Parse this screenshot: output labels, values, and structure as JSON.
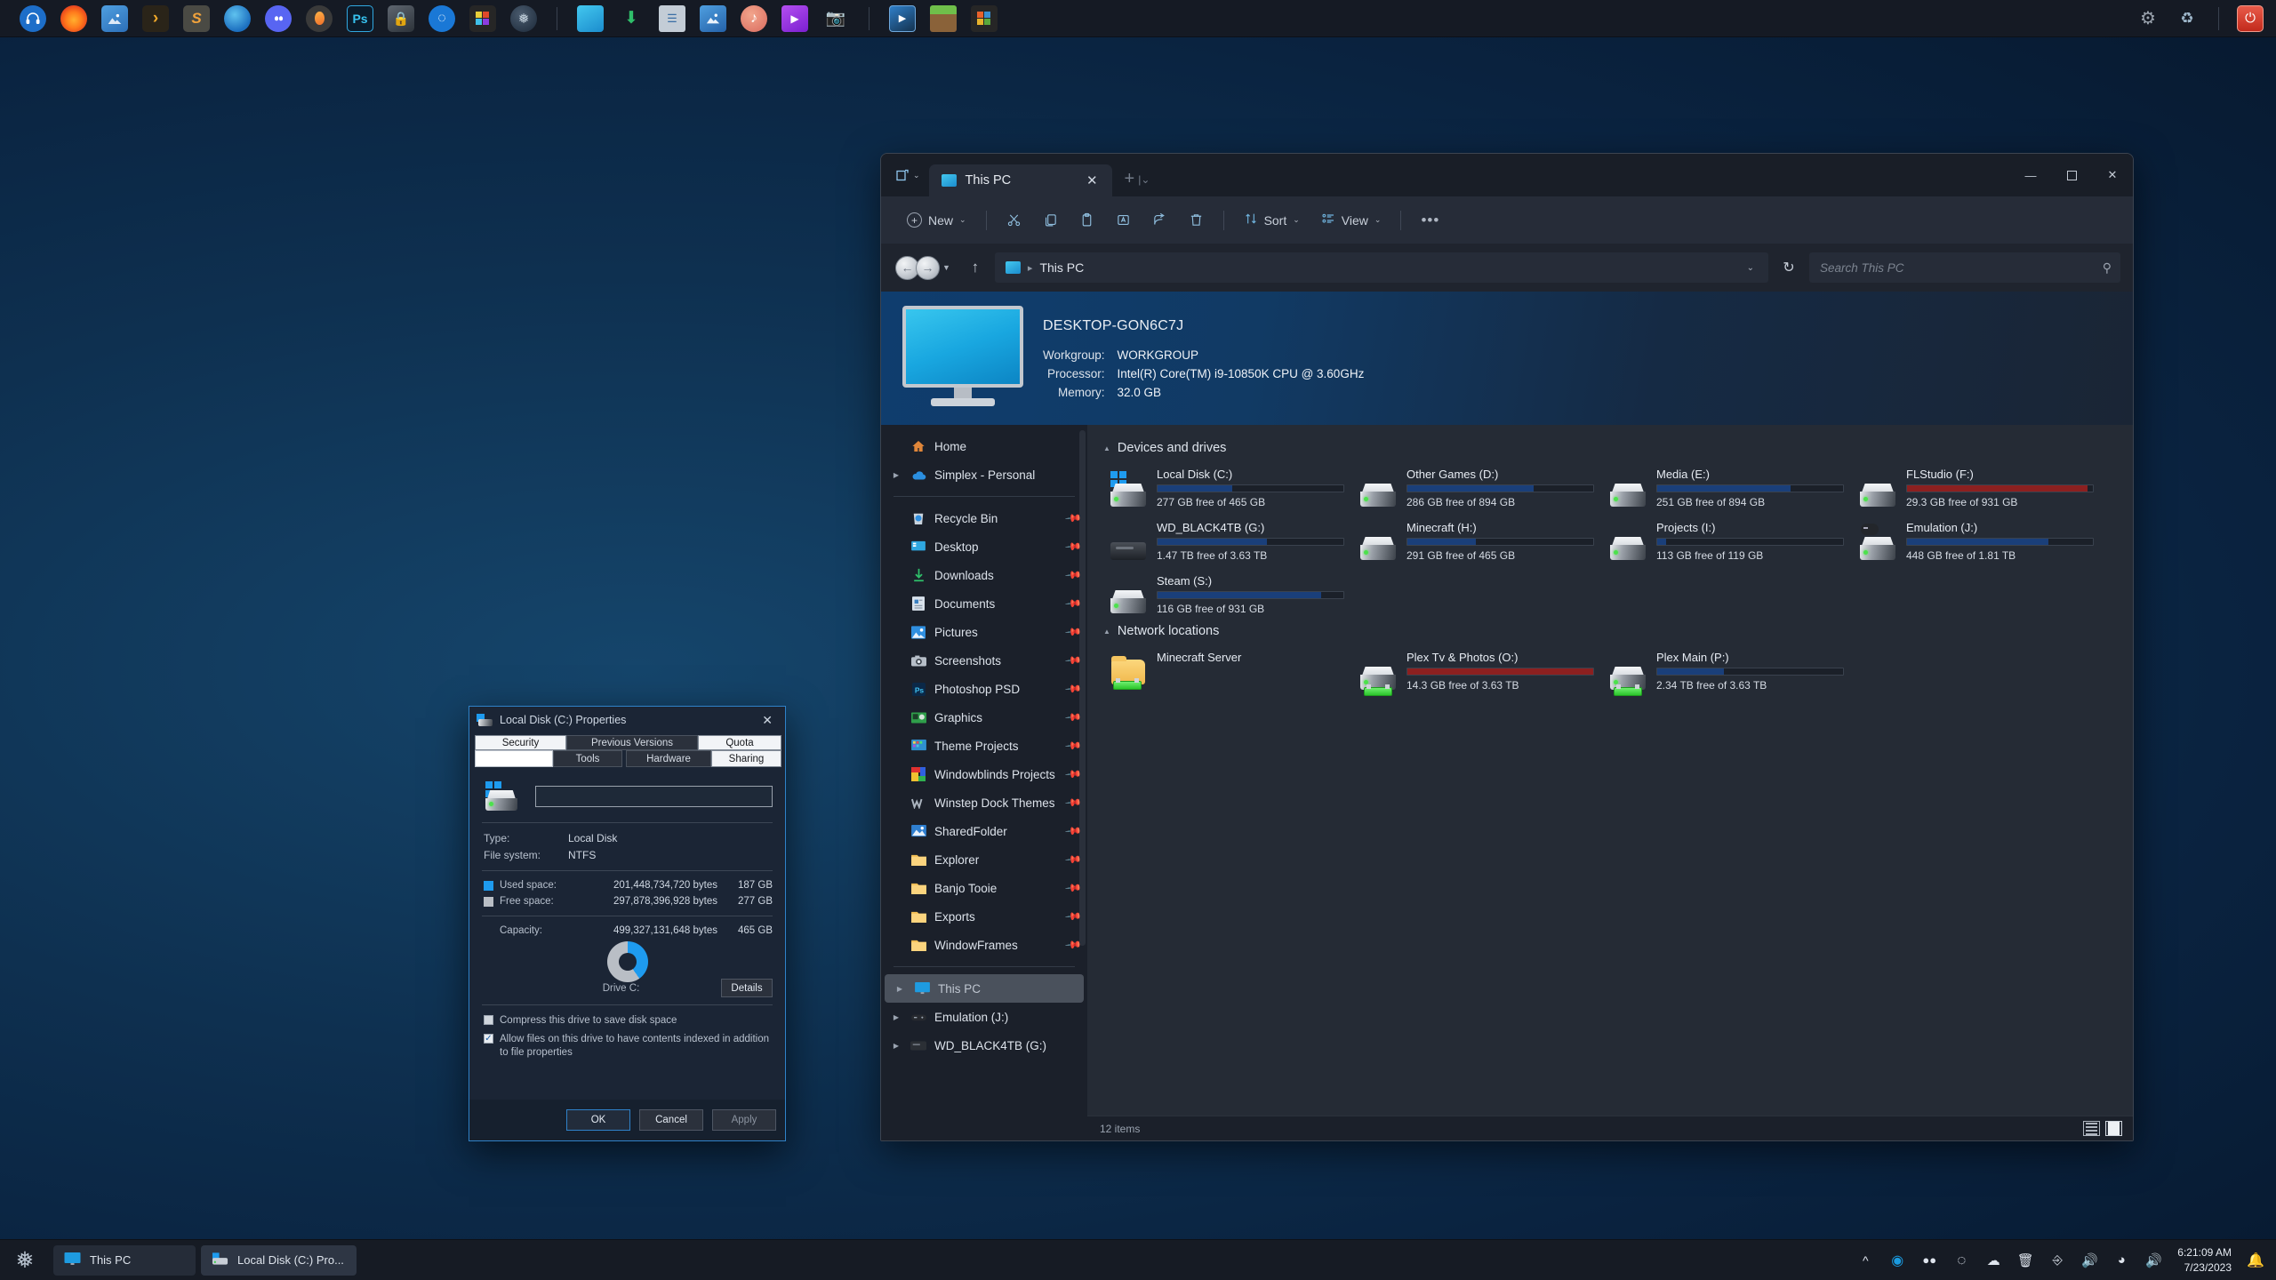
{
  "desktop": {
    "background_colors": [
      "#15456b",
      "#0e3050",
      "#0a2340",
      "#05111f"
    ]
  },
  "top_dock": {
    "left_icons": [
      {
        "name": "audio-headphones-icon",
        "glyph": "♫",
        "bg": "#1d6ec9",
        "fg": "#ffffff"
      },
      {
        "name": "firefox-icon",
        "glyph": "◕",
        "bg": "#2b2b2b",
        "fg": "#ff8a2b"
      },
      {
        "name": "image-viewer-icon",
        "glyph": "⛰",
        "bg": "#2f7fd0",
        "fg": "#ffffff"
      },
      {
        "name": "powershell-icon",
        "glyph": "›",
        "bg": "#2a2419",
        "fg": "#f0a82a"
      },
      {
        "name": "sublime-text-icon",
        "glyph": "S",
        "bg": "#4a4a44",
        "fg": "#f2a33c"
      },
      {
        "name": "thunderbird-icon",
        "glyph": "✉",
        "bg": "#1c6fbf",
        "fg": "#ffffff"
      },
      {
        "name": "discord-icon",
        "glyph": "●",
        "bg": "#5865f2",
        "fg": "#ffffff"
      },
      {
        "name": "fl-studio-icon",
        "glyph": "◑",
        "bg": "#3a3a3a",
        "fg": "#f07b2a"
      },
      {
        "name": "photoshop-icon",
        "glyph": "Ps",
        "bg": "#0b1b2b",
        "fg": "#37c3f0"
      },
      {
        "name": "secure-folder-icon",
        "glyph": "⚿",
        "bg": "#3b424b",
        "fg": "#cfd5dc"
      },
      {
        "name": "chrome-browser-icon",
        "glyph": "◎",
        "bg": "#1a78d6",
        "fg": "#ffffff"
      },
      {
        "name": "rubik-cube-icon",
        "glyph": "❖",
        "bg": "#2b2b2b",
        "fg": "#e84b9b"
      },
      {
        "name": "steam-icon",
        "glyph": "❁",
        "bg": "#1b2838",
        "fg": "#c7d5e0"
      }
    ],
    "right_group_icons": [
      {
        "name": "this-pc-icon",
        "glyph": "▣",
        "bg": "#1e9be0",
        "fg": "#ffffff"
      },
      {
        "name": "downloads-icon",
        "glyph": "⬇",
        "bg": "transparent",
        "fg": "#2fbf6a"
      },
      {
        "name": "documents-icon",
        "glyph": "☰",
        "bg": "#c3ccd6",
        "fg": "#3a6ea5"
      },
      {
        "name": "pictures-icon",
        "glyph": "⛰",
        "bg": "#2f7fd0",
        "fg": "#ffffff"
      },
      {
        "name": "music-icon",
        "glyph": "♪",
        "bg": "#e08a72",
        "fg": "#ffffff"
      },
      {
        "name": "videos-icon",
        "glyph": "▶",
        "bg": "#a23de0",
        "fg": "#ffffff"
      },
      {
        "name": "screenshots-camera-icon",
        "glyph": "◉",
        "bg": "#8e959e",
        "fg": "#ffffff"
      },
      {
        "name": "media-player-icon",
        "glyph": "▶",
        "bg": "#2a6ea8",
        "fg": "#ffffff"
      },
      {
        "name": "minecraft-icon",
        "glyph": "▦",
        "bg": "#7a5a36",
        "fg": "#6fbf4a"
      },
      {
        "name": "office-icon",
        "glyph": "❖",
        "bg": "#2b2b2b",
        "fg": "#e8622c"
      }
    ],
    "tray_icons": [
      {
        "name": "settings-gear-icon",
        "glyph": "⚙",
        "fg": "#9aa3ae"
      },
      {
        "name": "recycle-bin-icon",
        "glyph": "♻",
        "fg": "#6fb8e8"
      },
      {
        "name": "power-button-icon",
        "glyph": "⏻",
        "fg": "#ffffff"
      }
    ]
  },
  "explorer": {
    "tab": {
      "title": "This PC",
      "icon": "this-pc-icon",
      "close_label": "✕",
      "new_tab_label": "+",
      "tab_list_caret": "⌄"
    },
    "window_controls": {
      "minimize": "—",
      "maximize": "☐",
      "close": "✕"
    },
    "toolbar": {
      "new_label": "New",
      "sort_label": "Sort",
      "view_label": "View",
      "more_label": "•••",
      "icons": [
        "cut-icon",
        "copy-icon",
        "paste-icon",
        "rename-icon",
        "share-icon",
        "delete-icon"
      ]
    },
    "address": {
      "back_glyph": "←",
      "forward_glyph": "→",
      "up_glyph": "↑",
      "crumb_icon": "this-pc-icon",
      "crumb_text": "This PC",
      "crumb_caret": "⌄",
      "refresh_glyph": "↻",
      "search_placeholder": "Search This PC",
      "search_value": "",
      "search_icon": "search-icon"
    },
    "system_banner": {
      "computer_name": "DESKTOP-GON6C7J",
      "rows": [
        {
          "key": "Workgroup:",
          "value": "WORKGROUP"
        },
        {
          "key": "Processor:",
          "value": "Intel(R) Core(TM) i9-10850K CPU @ 3.60GHz"
        },
        {
          "key": "Memory:",
          "value": "32.0 GB"
        }
      ]
    },
    "sidebar": {
      "top_items": [
        {
          "label": "Home",
          "icon": "home-icon",
          "expandable": false,
          "pinned": false
        },
        {
          "label": "Simplex - Personal",
          "icon": "onedrive-cloud-icon",
          "expandable": true,
          "pinned": false
        }
      ],
      "quick_access": [
        {
          "label": "Recycle Bin",
          "icon": "recycle-bin-icon",
          "pinned": true
        },
        {
          "label": "Desktop",
          "icon": "desktop-icon",
          "pinned": true
        },
        {
          "label": "Downloads",
          "icon": "downloads-icon",
          "pinned": true
        },
        {
          "label": "Documents",
          "icon": "documents-icon",
          "pinned": true
        },
        {
          "label": "Pictures",
          "icon": "pictures-icon",
          "pinned": true
        },
        {
          "label": "Screenshots",
          "icon": "camera-icon",
          "pinned": true
        },
        {
          "label": "Photoshop PSD",
          "icon": "photoshop-icon",
          "pinned": true
        },
        {
          "label": "Graphics",
          "icon": "graphics-card-icon",
          "pinned": true
        },
        {
          "label": "Theme Projects",
          "icon": "theme-icon",
          "pinned": true
        },
        {
          "label": "Windowblinds Projects",
          "icon": "windowblinds-icon",
          "pinned": true
        },
        {
          "label": "Winstep Dock Themes",
          "icon": "winstep-icon",
          "pinned": true
        },
        {
          "label": "SharedFolder",
          "icon": "shared-folder-icon",
          "pinned": true
        },
        {
          "label": "Explorer",
          "icon": "folder-icon",
          "pinned": true
        },
        {
          "label": "Banjo Tooie",
          "icon": "folder-icon",
          "pinned": true
        },
        {
          "label": "Exports",
          "icon": "folder-icon",
          "pinned": true
        },
        {
          "label": "WindowFrames",
          "icon": "folder-icon",
          "pinned": true
        }
      ],
      "tree_items": [
        {
          "label": "This PC",
          "icon": "this-pc-icon",
          "expandable": true,
          "selected": true
        },
        {
          "label": "Emulation (J:)",
          "icon": "gamepad-drive-icon",
          "expandable": true,
          "selected": false
        },
        {
          "label": "WD_BLACK4TB (G:)",
          "icon": "external-hdd-icon",
          "expandable": true,
          "selected": false
        }
      ]
    },
    "content": {
      "groups": [
        {
          "title": "Devices and drives",
          "items": [
            {
              "name": "Local Disk (C:)",
              "free": "277 GB free of 465 GB",
              "used_pct": 40,
              "bar_color": "#1a3f7a",
              "icon": "windows-drive-icon"
            },
            {
              "name": "Other Games (D:)",
              "free": "286 GB free of 894 GB",
              "used_pct": 68,
              "bar_color": "#1a3f7a",
              "icon": "drive-icon"
            },
            {
              "name": "Media (E:)",
              "free": "251 GB free of 894 GB",
              "used_pct": 72,
              "bar_color": "#1a3f7a",
              "icon": "drive-icon"
            },
            {
              "name": "FLStudio (F:)",
              "free": "29.3 GB free of 931 GB",
              "used_pct": 97,
              "bar_color": "#8c2020",
              "icon": "drive-icon"
            },
            {
              "name": "WD_BLACK4TB (G:)",
              "free": "1.47 TB free of 3.63 TB",
              "used_pct": 59,
              "bar_color": "#1a3f7a",
              "icon": "external-hdd-icon"
            },
            {
              "name": "Minecraft (H:)",
              "free": "291 GB free of 465 GB",
              "used_pct": 37,
              "bar_color": "#1a3f7a",
              "icon": "drive-icon"
            },
            {
              "name": "Projects (I:)",
              "free": "113 GB free of 119 GB",
              "used_pct": 5,
              "bar_color": "#1a3f7a",
              "icon": "drive-icon"
            },
            {
              "name": "Emulation (J:)",
              "free": "448 GB free of 1.81 TB",
              "used_pct": 76,
              "bar_color": "#1a3f7a",
              "icon": "gamepad-drive-icon"
            },
            {
              "name": "Steam (S:)",
              "free": "116 GB free of 931 GB",
              "used_pct": 88,
              "bar_color": "#1a3f7a",
              "icon": "drive-icon"
            }
          ]
        },
        {
          "title": "Network locations",
          "items": [
            {
              "name": "Minecraft Server",
              "free": "",
              "used_pct": 0,
              "bar_color": "",
              "icon": "network-folder-icon"
            },
            {
              "name": "Plex Tv & Photos (O:)",
              "free": "14.3 GB free of 3.63 TB",
              "used_pct": 100,
              "bar_color": "#8c2020",
              "icon": "network-drive-icon"
            },
            {
              "name": "Plex Main (P:)",
              "free": "2.34 TB free of 3.63 TB",
              "used_pct": 36,
              "bar_color": "#1a3f7a",
              "icon": "network-drive-icon"
            }
          ]
        }
      ]
    },
    "statusbar": {
      "item_count": "12 items",
      "view_buttons": [
        "details-view-icon",
        "tiles-view-icon"
      ]
    }
  },
  "properties_dialog": {
    "title": "Local Disk (C:) Properties",
    "close_label": "✕",
    "tabs_row1": [
      "Security",
      "Previous Versions",
      "Quota"
    ],
    "tabs_row2": [
      "",
      "Tools",
      "Hardware",
      "Sharing"
    ],
    "active_tab": "Sharing",
    "volume_label_value": "",
    "fields": [
      {
        "key": "Type:",
        "value": "Local Disk"
      },
      {
        "key": "File system:",
        "value": "NTFS"
      }
    ],
    "space": [
      {
        "swatch": "#1e9bef",
        "label": "Used space:",
        "bytes": "201,448,734,720 bytes",
        "gb": "187 GB"
      },
      {
        "swatch": "#b9bec5",
        "label": "Free space:",
        "bytes": "297,878,396,928 bytes",
        "gb": "277 GB"
      }
    ],
    "capacity": {
      "label": "Capacity:",
      "bytes": "499,327,131,648 bytes",
      "gb": "465 GB"
    },
    "drive_caption": "Drive C:",
    "details_button": "Details",
    "checkboxes": [
      {
        "label": "Compress this drive to save disk space",
        "checked": false
      },
      {
        "label": "Allow files on this drive to have contents indexed in addition to file properties",
        "checked": true
      }
    ],
    "buttons": {
      "ok": "OK",
      "cancel": "Cancel",
      "apply": "Apply"
    }
  },
  "taskbar": {
    "start_icon": "steam-start-icon",
    "tasks": [
      {
        "label": "This PC",
        "icon": "this-pc-icon",
        "active": false
      },
      {
        "label": "Local Disk (C:) Pro...",
        "icon": "drive-icon",
        "active": true
      }
    ],
    "tray": [
      {
        "name": "show-hidden-icons-chevron",
        "glyph": "⌃"
      },
      {
        "name": "browser-tray-icon",
        "glyph": "●"
      },
      {
        "name": "discord-tray-icon",
        "glyph": "●"
      },
      {
        "name": "nvidia-tray-icon",
        "glyph": "◎"
      },
      {
        "name": "onedrive-cloud-tray-icon",
        "glyph": "☁"
      },
      {
        "name": "recycle-bin-tray-icon",
        "glyph": "Ὕ1"
      },
      {
        "name": "usb-eject-tray-icon",
        "glyph": "⎙"
      },
      {
        "name": "volume-tray-icon",
        "glyph": "🔊"
      },
      {
        "name": "wifi-tray-icon",
        "glyph": "◠"
      },
      {
        "name": "speaker-tray-icon",
        "glyph": "🔊"
      }
    ],
    "clock": {
      "time": "6:21:09 AM",
      "date": "7/23/2023"
    },
    "notification_icon": "notification-bell-icon"
  }
}
